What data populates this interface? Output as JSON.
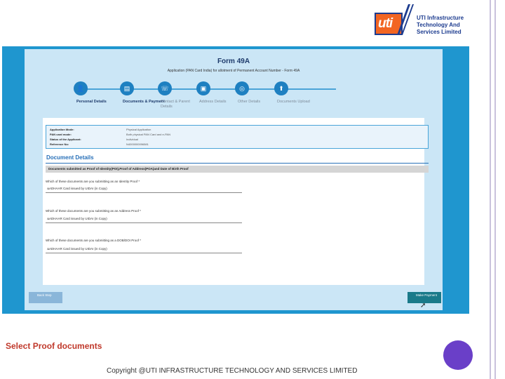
{
  "logo": {
    "mark": "uti",
    "lines": [
      "UTI Infrastructure",
      "Technology And",
      "Services Limited"
    ]
  },
  "form": {
    "title": "Form 49A",
    "subtitle": "Application (PAN Card India) for allotment of Permanent Account Number - Form 49A"
  },
  "steps": [
    {
      "label": "Personal Details",
      "icon": "user-icon",
      "glyph": "👤",
      "state": "done"
    },
    {
      "label": "Documents & Payment",
      "icon": "document-icon",
      "glyph": "▤",
      "state": "done"
    },
    {
      "label": "Contact & Parent Details",
      "icon": "contact-icon",
      "glyph": "☏",
      "state": "todo"
    },
    {
      "label": "Address Details",
      "icon": "address-card-icon",
      "glyph": "▣",
      "state": "todo"
    },
    {
      "label": "Other Details",
      "icon": "other-icon",
      "glyph": "◎",
      "state": "todo"
    },
    {
      "label": "Documents Upload",
      "icon": "upload-icon",
      "glyph": "⬆",
      "state": "todo"
    }
  ],
  "info": [
    {
      "key": "Application Mode:",
      "value": "Physical Application"
    },
    {
      "key": "PAN card mode:",
      "value": "Both physical PAN Card and e-PAN"
    },
    {
      "key": "Status of the Applicant:",
      "value": "Individual"
    },
    {
      "key": "Reference No:",
      "value": "N4000000096581"
    }
  ],
  "documents": {
    "title": "Document Details",
    "bar": "Documents submitted as Proof of Identity(POI),Proof of Address(POA)and Date of Birth Proof",
    "fields": [
      {
        "question": "Which of these documents are you submitting as an Identity Proof *",
        "value": "AADHAAR Card issued by UIDAI (in Copy)"
      },
      {
        "question": "Which of these documents are you submitting as an Address Proof *",
        "value": "AADHAAR Card issued by UIDAI (in Copy)"
      },
      {
        "question": "Which of these documents are you submitting as a DOB/DOI Proof *",
        "value": "AADHAAR Card issued by UIDAI (in Copy)"
      }
    ]
  },
  "buttons": {
    "back": "Back Step",
    "pay": "Make Payment"
  },
  "caption": "Select Proof documents",
  "copyright": "Copyright @UTI INFRASTRUCTURE TECHNOLOGY AND SERVICES LIMITED",
  "colors": {
    "accent": "#1f96cf",
    "brand_orange": "#f26522",
    "caption": "#c0392b"
  }
}
